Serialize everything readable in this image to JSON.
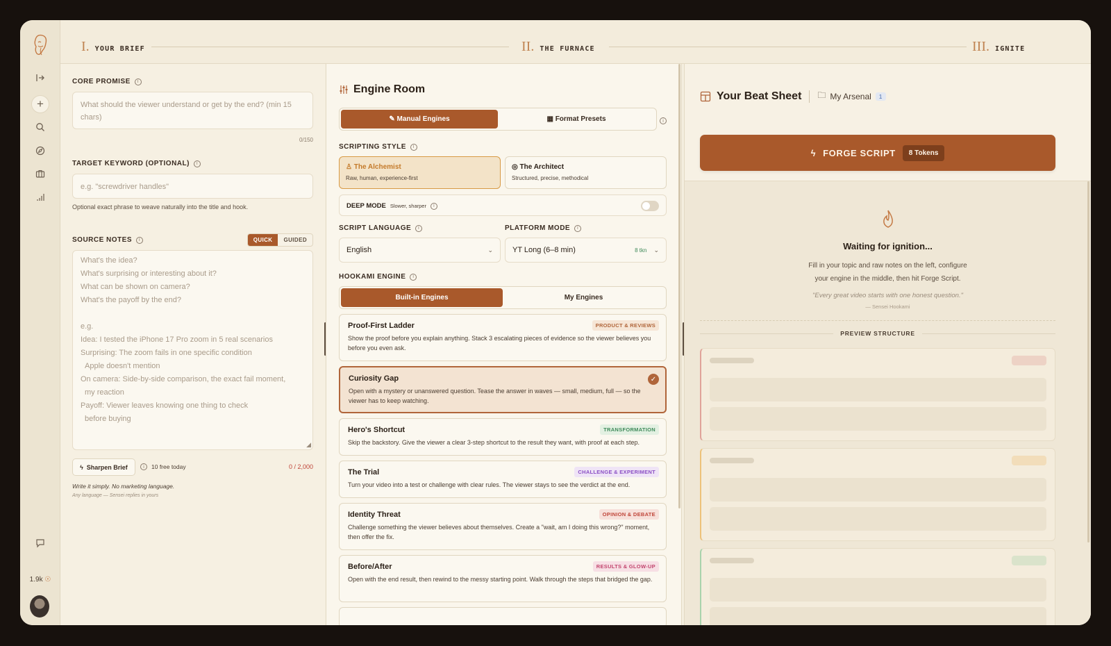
{
  "sidebar": {
    "icons": [
      "logo-icon",
      "collapse-icon",
      "plus-icon",
      "search-icon",
      "compass-icon",
      "briefcase-icon",
      "chart-icon",
      "chat-icon",
      "coin-icon"
    ],
    "credits": "1.9k"
  },
  "stepper": {
    "steps": [
      {
        "num": "I.",
        "label": "YOUR BRIEF"
      },
      {
        "num": "II.",
        "label": "THE FURNACE"
      },
      {
        "num": "III.",
        "label": "IGNITE"
      }
    ]
  },
  "brief": {
    "core_promise": {
      "label": "CORE PROMISE",
      "placeholder": "What should the viewer understand or get by the end? (min 15 chars)",
      "counter": "0/150"
    },
    "keyword": {
      "label": "TARGET KEYWORD (OPTIONAL)",
      "placeholder": "e.g. \"screwdriver handles\"",
      "hint": "Optional exact phrase to weave naturally into the title and hook."
    },
    "notes": {
      "label": "SOURCE NOTES",
      "mode_quick": "QUICK",
      "mode_guided": "GUIDED",
      "lines": [
        "What's the idea?",
        "What's surprising or interesting about it?",
        "What can be shown on camera?",
        "What's the payoff by the end?",
        "",
        "e.g.",
        "Idea: I tested the iPhone 17 Pro zoom in 5 real scenarios",
        "Surprising: The zoom fails in one specific condition",
        "  Apple doesn't mention",
        "On camera: Side-by-side comparison, the exact fail moment,",
        "  my reaction",
        "Payoff: Viewer leaves knowing one thing to check",
        "  before buying"
      ],
      "sharpen_label": "Sharpen Brief",
      "free_today": "10 free today",
      "char_count": "0 / 2,000",
      "tip": "Write it simply. No marketing language.",
      "tip_sub": "Any language — Sensei replies in yours"
    }
  },
  "engine_room": {
    "title": "Engine Room",
    "tabs": [
      "Manual Engines",
      "Format Presets"
    ],
    "scripting_style_label": "SCRIPTING STYLE",
    "styles": [
      {
        "title": "The Alchemist",
        "sub": "Raw, human, experience-first"
      },
      {
        "title": "The Architect",
        "sub": "Structured, precise, methodical"
      }
    ],
    "deep_mode": {
      "label": "DEEP MODE",
      "sub": "Slower, sharper"
    },
    "language": {
      "label": "SCRIPT LANGUAGE",
      "value": "English"
    },
    "platform": {
      "label": "PLATFORM MODE",
      "value": "YT Long (6–8 min)",
      "cost": "8 tkn"
    },
    "hookami_label": "HOOKAMI ENGINE",
    "hookami_tabs": [
      "Built-in Engines",
      "My Engines"
    ],
    "engines": [
      {
        "title": "Proof-First Ladder",
        "badge": "PRODUCT & REVIEWS",
        "badge_fg": "#b0653a",
        "badge_bg": "#f6e6d6",
        "desc": "Show the proof before you explain anything. Stack 3 escalating pieces of evidence so the viewer believes you before you even ask."
      },
      {
        "title": "Curiosity Gap",
        "badge": "",
        "desc": "Open with a mystery or unanswered question. Tease the answer in waves — small, medium, full — so the viewer has to keep watching."
      },
      {
        "title": "Hero's Shortcut",
        "badge": "TRANSFORMATION",
        "badge_fg": "#3f8a5a",
        "badge_bg": "#e3f0e2",
        "desc": "Skip the backstory. Give the viewer a clear 3-step shortcut to the result they want, with proof at each step."
      },
      {
        "title": "The Trial",
        "badge": "CHALLENGE & EXPERIMENT",
        "badge_fg": "#8b4fc4",
        "badge_bg": "#efe4f6",
        "desc": "Turn your video into a test or challenge with clear rules. The viewer stays to see the verdict at the end."
      },
      {
        "title": "Identity Threat",
        "badge": "OPINION & DEBATE",
        "badge_fg": "#c0463a",
        "badge_bg": "#f7e0da",
        "desc": "Challenge something the viewer believes about themselves. Create a \"wait, am I doing this wrong?\" moment, then offer the fix."
      },
      {
        "title": "Before/After",
        "badge": "RESULTS & GLOW-UP",
        "badge_fg": "#c2466e",
        "badge_bg": "#f7dfe4",
        "desc": "Open with the end result, then rewind to the messy starting point. Walk through the steps that bridged the gap."
      }
    ]
  },
  "beat_sheet": {
    "title": "Your Beat Sheet",
    "arsenal_label": "My Arsenal",
    "arsenal_count": "1",
    "forge_label": "FORGE SCRIPT",
    "forge_tokens": "8 Tokens",
    "waiting_title": "Waiting for ignition...",
    "waiting_line1": "Fill in your topic and raw notes on the left, configure",
    "waiting_line2": "your engine in the middle, then hit Forge Script.",
    "quote": "\"Every great video starts with one honest question.\"",
    "quote_author": "— Sensei Hookami",
    "preview_label": "PREVIEW STRUCTURE",
    "accent_colors": [
      "#e0a39a",
      "#edc27a",
      "#a9d3ac"
    ]
  }
}
